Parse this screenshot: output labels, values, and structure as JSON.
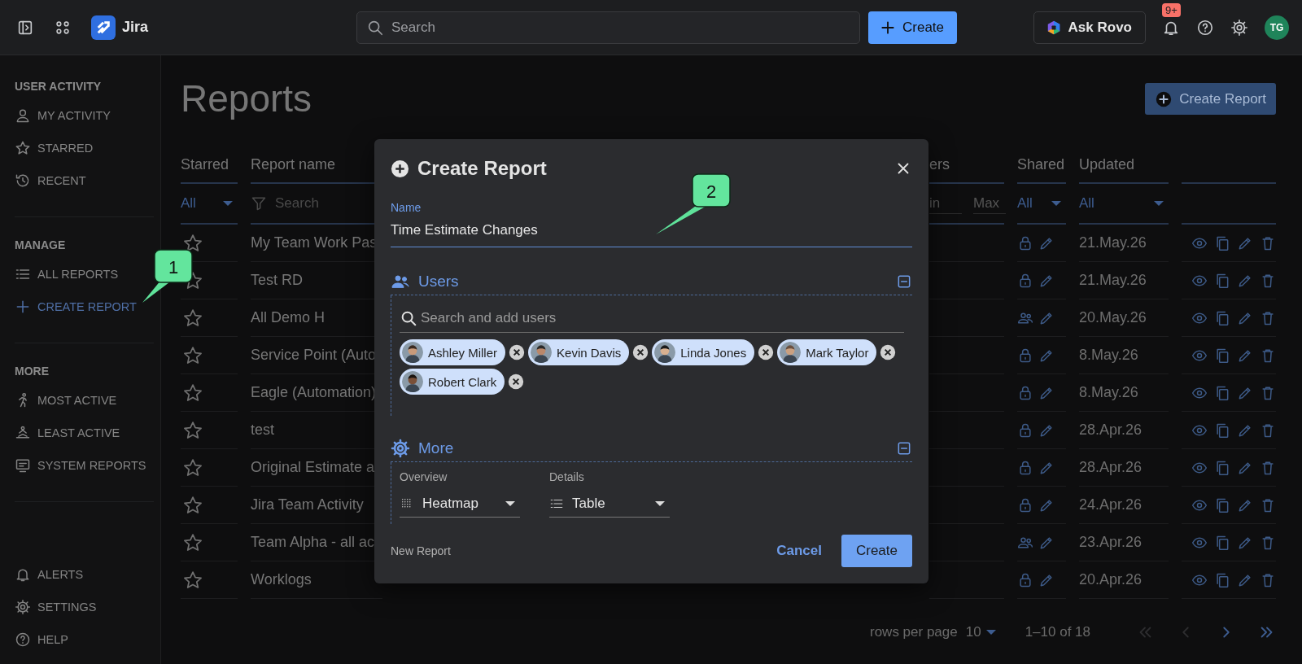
{
  "topbar": {
    "app_name": "Jira",
    "search_placeholder": "Search",
    "create_label": "Create",
    "ask_label": "Ask Rovo",
    "notification_badge": "9+",
    "avatar_initials": "TG"
  },
  "sidebar": {
    "sections": [
      {
        "title": "USER ACTIVITY",
        "items": [
          {
            "label": "MY ACTIVITY",
            "selected": false
          },
          {
            "label": "STARRED",
            "selected": false
          },
          {
            "label": "RECENT",
            "selected": false
          }
        ]
      },
      {
        "title": "MANAGE",
        "items": [
          {
            "label": "ALL REPORTS",
            "selected": false
          },
          {
            "label": "CREATE REPORT",
            "selected": true
          }
        ]
      },
      {
        "title": "MORE",
        "items": [
          {
            "label": "MOST ACTIVE",
            "selected": false
          },
          {
            "label": "LEAST ACTIVE",
            "selected": false
          },
          {
            "label": "SYSTEM REPORTS",
            "selected": false
          }
        ]
      }
    ],
    "footer_items": [
      {
        "label": "ALERTS",
        "selected": false
      },
      {
        "label": "SETTINGS",
        "selected": false
      },
      {
        "label": "HELP",
        "selected": false
      }
    ]
  },
  "page": {
    "title": "Reports",
    "create_button": "Create Report"
  },
  "table": {
    "columns": [
      {
        "label": "Starred"
      },
      {
        "label": "Report name"
      },
      {
        "label": "ers"
      },
      {
        "label": "Shared"
      },
      {
        "label": "Updated"
      }
    ],
    "filters": {
      "starred": "All",
      "name_placeholder": "Search",
      "min_placeholder": "in",
      "max_placeholder": "Max",
      "shared": "All",
      "updated": "All"
    },
    "rows": [
      {
        "kind": "private",
        "starred": false,
        "name": "My Team Work Pas",
        "updated": "21.May.26"
      },
      {
        "kind": "private",
        "starred": false,
        "name": "Test RD",
        "updated": "21.May.26"
      },
      {
        "kind": "group",
        "starred": false,
        "name": "All Demo H",
        "updated": "20.May.26"
      },
      {
        "kind": "private",
        "starred": false,
        "name": "Service Point (Auto",
        "updated": "8.May.26"
      },
      {
        "kind": "private",
        "starred": false,
        "name": "Eagle (Automation)",
        "updated": "8.May.26"
      },
      {
        "kind": "private",
        "starred": false,
        "name": "test",
        "updated": "28.Apr.26"
      },
      {
        "kind": "private",
        "starred": false,
        "name": "Original Estimate a",
        "updated": "28.Apr.26"
      },
      {
        "kind": "private",
        "starred": false,
        "name": "Jira Team Activity",
        "updated": "24.Apr.26"
      },
      {
        "kind": "group",
        "starred": false,
        "name": "Team Alpha - all ac",
        "updated": "23.Apr.26"
      },
      {
        "kind": "private",
        "starred": false,
        "name": "Worklogs",
        "updated": "20.Apr.26"
      }
    ]
  },
  "pagination": {
    "rows_label": "rows per page",
    "rows_value": "10",
    "range": "1–10 of 18",
    "first_disabled": true,
    "prev_disabled": true,
    "next_disabled": false,
    "last_disabled": false
  },
  "dialog": {
    "title": "Create Report",
    "name_label": "Name",
    "name_value": "Time Estimate Changes",
    "users": {
      "title": "Users",
      "search_placeholder": "Search and add users",
      "chips": [
        {
          "name": "Ashley Miller"
        },
        {
          "name": "Kevin Davis"
        },
        {
          "name": "Linda Jones"
        },
        {
          "name": "Mark Taylor"
        },
        {
          "name": "Robert Clark"
        }
      ]
    },
    "more": {
      "title": "More",
      "overview_label": "Overview",
      "overview_value": "Heatmap",
      "details_label": "Details",
      "details_value": "Table"
    },
    "footer_note": "New Report",
    "cancel_label": "Cancel",
    "create_label": "Create"
  },
  "callouts": [
    {
      "number": "1"
    },
    {
      "number": "2"
    }
  ]
}
